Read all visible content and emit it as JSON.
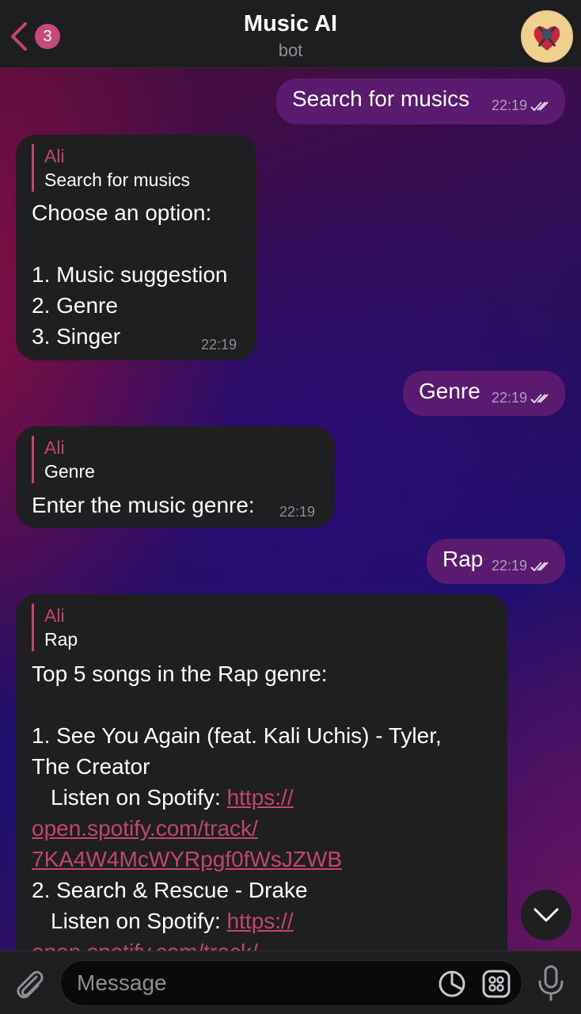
{
  "header": {
    "back_count": "3",
    "title": "Music AI",
    "subtitle": "bot"
  },
  "messages": {
    "m1": {
      "text": "Search for musics",
      "time": "22:19"
    },
    "m2": {
      "reply_name": "Ali",
      "reply_text": "Search for musics",
      "lines": [
        "Choose an option:",
        "",
        "1. Music suggestion",
        "2. Genre",
        "3. Singer"
      ],
      "time": "22:19"
    },
    "m3": {
      "text": "Genre",
      "time": "22:19"
    },
    "m4": {
      "reply_name": "Ali",
      "reply_text": "Genre",
      "text": "Enter the music genre:",
      "time": "22:19"
    },
    "m5": {
      "text": "Rap",
      "time": "22:19"
    },
    "m6": {
      "reply_name": "Ali",
      "reply_text": "Rap",
      "heading": "Top 5 songs in the Rap genre:",
      "song1_line1": "1. See You Again (feat. Kali Uchis) - Tyler,",
      "song1_line2": "The Creator",
      "listen_label": "Listen on Spotify: ",
      "song1_link_1": "https://",
      "song1_link_2": "open.spotify.com/track/",
      "song1_link_3": "7KA4W4McWYRpgf0fWsJZWB",
      "song2_line1": "2. Search & Rescue - Drake",
      "song2_link_1": "https://",
      "song2_link_2": "open.spotify.com/track/"
    }
  },
  "input": {
    "placeholder": "Message"
  },
  "colors": {
    "accent": "#c0456f",
    "outgoing_bubble": "#5a1a70",
    "incoming_bubble": "#1f1f22",
    "badge": "#c44a78"
  },
  "icons": {
    "back": "chevron-left-icon",
    "scroll": "chevron-down-icon",
    "attach": "paperclip-icon",
    "sticker": "sticker-icon",
    "emoji": "emoji-keyboard-icon",
    "mic": "microphone-icon"
  }
}
